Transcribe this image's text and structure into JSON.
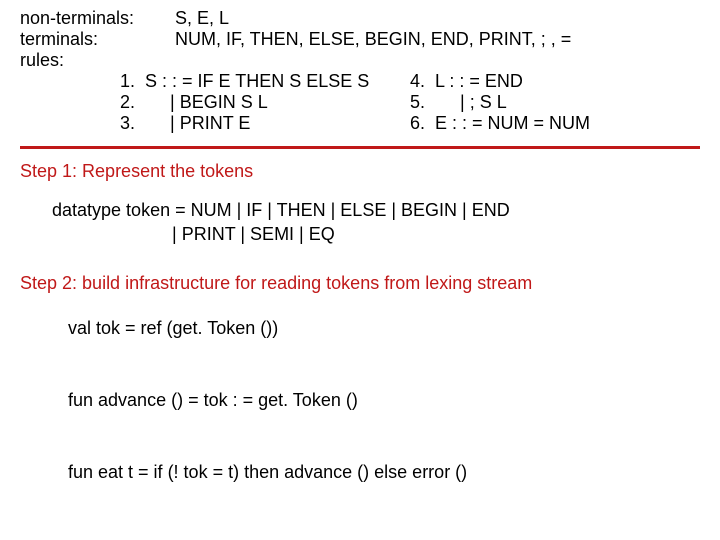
{
  "grammar": {
    "nonterm_label": "non-terminals:",
    "nonterm_value": "S, E, L",
    "term_label": "terminals:",
    "term_value": "NUM, IF, THEN, ELSE, BEGIN, END, PRINT, ; , =",
    "rules_label": "rules:",
    "left": {
      "r1": "1.  S : : = IF E THEN S ELSE S",
      "r2": "2.       | BEGIN S L",
      "r3": "3.       | PRINT E"
    },
    "right": {
      "r4": "4.  L : : = END",
      "r5": "5.       | ; S L",
      "r6": "6.  E : : = NUM = NUM"
    }
  },
  "step1": {
    "title": "Step 1: Represent the tokens",
    "code": "datatype token = NUM | IF | THEN | ELSE | BEGIN | END\n                        | PRINT | SEMI | EQ"
  },
  "step2": {
    "title": "Step 2: build infrastructure for reading tokens from lexing stream",
    "code": "val tok = ref (get. Token ())\n\nfun advance () = tok : = get. Token ()\n\nfun eat t = if (! tok = t) then advance () else error ()"
  }
}
